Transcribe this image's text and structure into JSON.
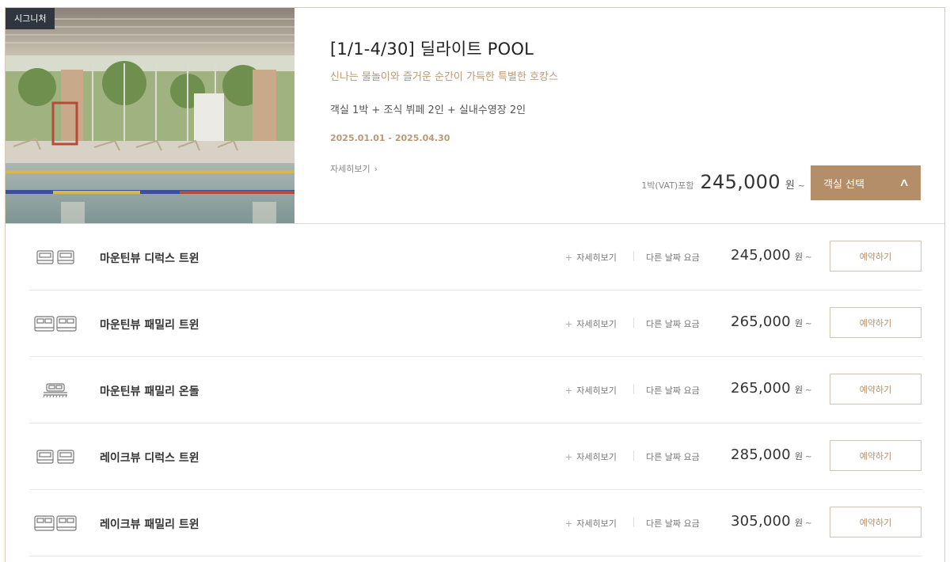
{
  "package": {
    "badge": "시그니처",
    "title": "[1/1-4/30] 딜라이트 POOL",
    "subtitle": "신나는 물놀이와 즐거운 순간이 가득한 특별한 호캉스",
    "includes": "객실 1박 + 조식 뷔페 2인 + 실내수영장 2인",
    "period": "2025.01.01 - 2025.04.30",
    "detail_link": "자세히보기",
    "price_label": "1박(VAT)포함",
    "price": "245,000",
    "currency": "원",
    "tilde": "~",
    "select_button": "객실 선택"
  },
  "rooms": [
    {
      "name": "마운틴뷰 디럭스 트윈",
      "detail": "자세히보기",
      "other_dates": "다른 날짜 요금",
      "price": "245,000",
      "currency": "원",
      "tilde": "~",
      "reserve": "예약하기",
      "icon": "twin-bed-icon"
    },
    {
      "name": "마운틴뷰 패밀리 트윈",
      "detail": "자세히보기",
      "other_dates": "다른 날짜 요금",
      "price": "265,000",
      "currency": "원",
      "tilde": "~",
      "reserve": "예약하기",
      "icon": "family-twin-bed-icon"
    },
    {
      "name": "마운틴뷰 패밀리 온돌",
      "detail": "자세히보기",
      "other_dates": "다른 날짜 요금",
      "price": "265,000",
      "currency": "원",
      "tilde": "~",
      "reserve": "예약하기",
      "icon": "ondol-floor-bed-icon"
    },
    {
      "name": "레이크뷰 디럭스 트윈",
      "detail": "자세히보기",
      "other_dates": "다른 날짜 요금",
      "price": "285,000",
      "currency": "원",
      "tilde": "~",
      "reserve": "예약하기",
      "icon": "twin-bed-icon"
    },
    {
      "name": "레이크뷰 패밀리 트윈",
      "detail": "자세히보기",
      "other_dates": "다른 날짜 요금",
      "price": "305,000",
      "currency": "원",
      "tilde": "~",
      "reserve": "예약하기",
      "icon": "family-twin-bed-icon"
    }
  ],
  "colors": {
    "accent": "#b38e69",
    "badge_bg": "#2f3640",
    "border": "#d9cbb8"
  }
}
